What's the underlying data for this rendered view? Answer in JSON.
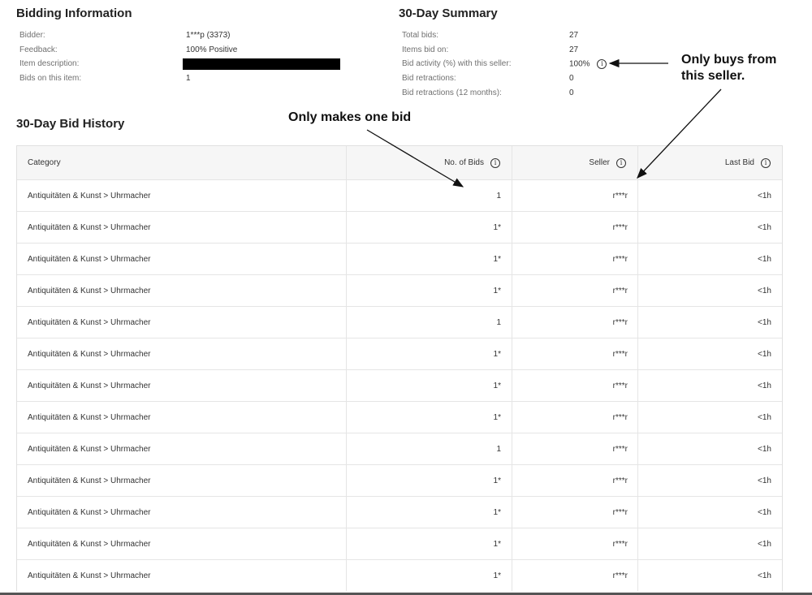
{
  "bidding_info": {
    "title": "Bidding Information",
    "rows": [
      {
        "label": "Bidder:",
        "value": "1***p (3373)"
      },
      {
        "label": "Feedback:",
        "value": "100% Positive"
      },
      {
        "label": "Item description:",
        "value": ""
      },
      {
        "label": "Bids on this item:",
        "value": "1"
      }
    ]
  },
  "summary": {
    "title": "30-Day Summary",
    "rows": [
      {
        "label": "Total bids:",
        "value": "27"
      },
      {
        "label": "Items bid on:",
        "value": "27"
      },
      {
        "label": "Bid activity (%) with this seller:",
        "value": "100%"
      },
      {
        "label": "Bid retractions:",
        "value": "0"
      },
      {
        "label": "Bid retractions (12 months):",
        "value": "0"
      }
    ]
  },
  "history": {
    "title": "30-Day Bid History",
    "columns": {
      "category": "Category",
      "bids": "No. of Bids",
      "seller": "Seller",
      "last_bid": "Last Bid"
    },
    "rows": [
      {
        "category": "Antiquitäten & Kunst > Uhrmacher",
        "bids": "1",
        "seller": "r***r",
        "last_bid": "<1h"
      },
      {
        "category": "Antiquitäten & Kunst > Uhrmacher",
        "bids": "1*",
        "seller": "r***r",
        "last_bid": "<1h"
      },
      {
        "category": "Antiquitäten & Kunst > Uhrmacher",
        "bids": "1*",
        "seller": "r***r",
        "last_bid": "<1h"
      },
      {
        "category": "Antiquitäten & Kunst > Uhrmacher",
        "bids": "1*",
        "seller": "r***r",
        "last_bid": "<1h"
      },
      {
        "category": "Antiquitäten & Kunst > Uhrmacher",
        "bids": "1",
        "seller": "r***r",
        "last_bid": "<1h"
      },
      {
        "category": "Antiquitäten & Kunst > Uhrmacher",
        "bids": "1*",
        "seller": "r***r",
        "last_bid": "<1h"
      },
      {
        "category": "Antiquitäten & Kunst > Uhrmacher",
        "bids": "1*",
        "seller": "r***r",
        "last_bid": "<1h"
      },
      {
        "category": "Antiquitäten & Kunst > Uhrmacher",
        "bids": "1*",
        "seller": "r***r",
        "last_bid": "<1h"
      },
      {
        "category": "Antiquitäten & Kunst > Uhrmacher",
        "bids": "1",
        "seller": "r***r",
        "last_bid": "<1h"
      },
      {
        "category": "Antiquitäten & Kunst > Uhrmacher",
        "bids": "1*",
        "seller": "r***r",
        "last_bid": "<1h"
      },
      {
        "category": "Antiquitäten & Kunst > Uhrmacher",
        "bids": "1*",
        "seller": "r***r",
        "last_bid": "<1h"
      },
      {
        "category": "Antiquitäten & Kunst > Uhrmacher",
        "bids": "1*",
        "seller": "r***r",
        "last_bid": "<1h"
      },
      {
        "category": "Antiquitäten & Kunst > Uhrmacher",
        "bids": "1*",
        "seller": "r***r",
        "last_bid": "<1h"
      }
    ]
  },
  "annotations": {
    "one_bid": "Only makes one bid",
    "one_seller_line1": "Only buys from",
    "one_seller_line2": "this seller."
  },
  "icons": {
    "info": "info-icon"
  }
}
